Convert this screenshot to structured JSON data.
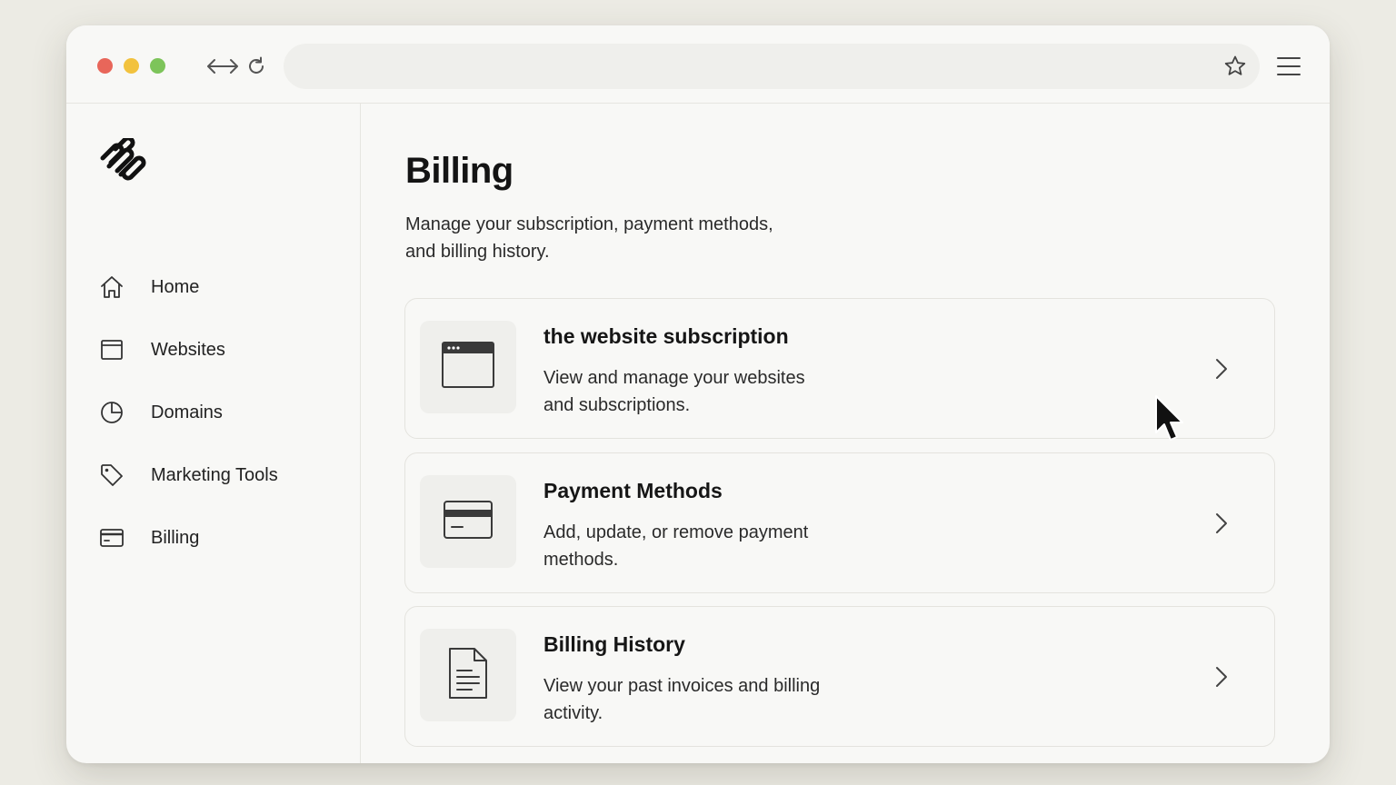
{
  "browser": {
    "address_value": "",
    "controls": {
      "back_forward_icon": "arrows-horizontal-icon",
      "reload_icon": "reload-icon",
      "bookmark_icon": "star-icon",
      "menu_icon": "hamburger-menu-icon"
    },
    "traffic_lights": {
      "close": "#e8665a",
      "minimize": "#f2c23e",
      "maximize": "#7dc45a"
    }
  },
  "sidebar": {
    "logo_icon": "squarespace-logo-icon",
    "items": [
      {
        "label": "Home",
        "icon": "home-icon"
      },
      {
        "label": "Websites",
        "icon": "browser-window-icon"
      },
      {
        "label": "Domains",
        "icon": "pie-chart-icon"
      },
      {
        "label": "Marketing Tools",
        "icon": "tag-icon"
      },
      {
        "label": "Billing",
        "icon": "credit-card-icon"
      }
    ]
  },
  "main": {
    "title": "Billing",
    "description": "Manage your subscription, payment methods, and billing history.",
    "cards": [
      {
        "title": "the website subscription",
        "description": "View and manage your websites and subscriptions.",
        "icon": "browser-window-icon"
      },
      {
        "title": "Payment Methods",
        "description": "Add, update, or remove payment methods.",
        "icon": "credit-card-icon"
      },
      {
        "title": "Billing History",
        "description": "View your past invoices and billing activity.",
        "icon": "document-icon"
      }
    ]
  },
  "colors": {
    "background": "#ecebe4",
    "window": "#f8f8f6",
    "text": "#1a1a1a"
  }
}
